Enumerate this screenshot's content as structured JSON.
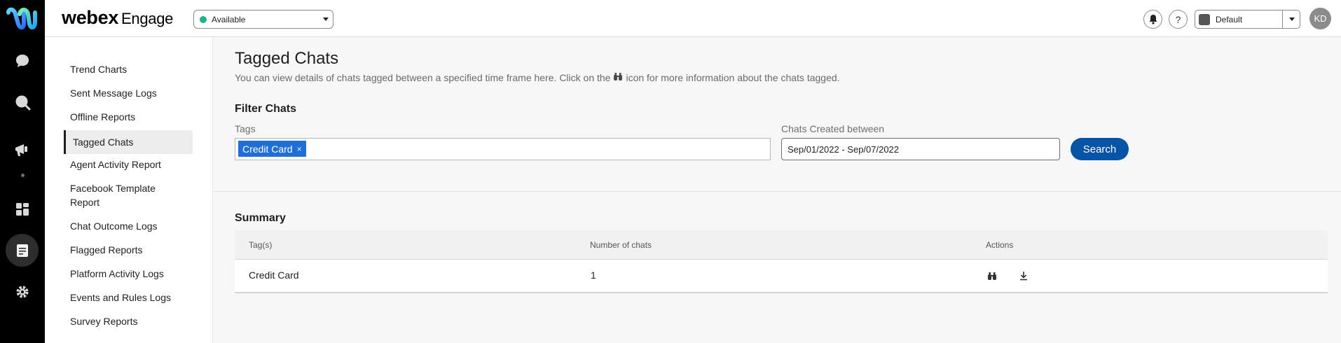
{
  "app": {
    "brand_name": "webex",
    "brand_product": "Engage",
    "status": "Available",
    "profile": "Default",
    "user_initials": "KD",
    "help_glyph": "?"
  },
  "rail_icons": [
    "chat-icon",
    "search-chat-icon",
    "campaign-icon",
    "dashboard-icon",
    "reports-icon",
    "settings-icon"
  ],
  "sidebar": {
    "items": [
      {
        "label": "Trend Charts"
      },
      {
        "label": "Sent Message Logs"
      },
      {
        "label": "Offline Reports"
      },
      {
        "label": "Tagged Chats",
        "active": true
      },
      {
        "label": "Agent Activity Report"
      },
      {
        "label": "Facebook Template Report"
      },
      {
        "label": "Chat Outcome Logs"
      },
      {
        "label": "Flagged Reports"
      },
      {
        "label": "Platform Activity Logs"
      },
      {
        "label": "Events and Rules Logs"
      },
      {
        "label": "Survey Reports"
      }
    ]
  },
  "page": {
    "title": "Tagged Chats",
    "desc_before": "You can view details of chats tagged between a specified time frame here. Click on the",
    "desc_after": "icon for more information about the chats tagged."
  },
  "filter": {
    "title": "Filter Chats",
    "tags_label": "Tags",
    "tag_chip": "Credit Card",
    "chip_remove": "×",
    "date_label": "Chats Created between",
    "date_value": "Sep/01/2022 - Sep/07/2022",
    "search_label": "Search"
  },
  "summary": {
    "title": "Summary",
    "columns": [
      "Tag(s)",
      "Number of chats",
      "Actions"
    ],
    "rows": [
      {
        "tag": "Credit Card",
        "count": "1"
      }
    ]
  },
  "colors": {
    "accent": "#0753a6",
    "chip": "#1f6fd6",
    "available": "#1eb28a",
    "rail": "#000000"
  }
}
